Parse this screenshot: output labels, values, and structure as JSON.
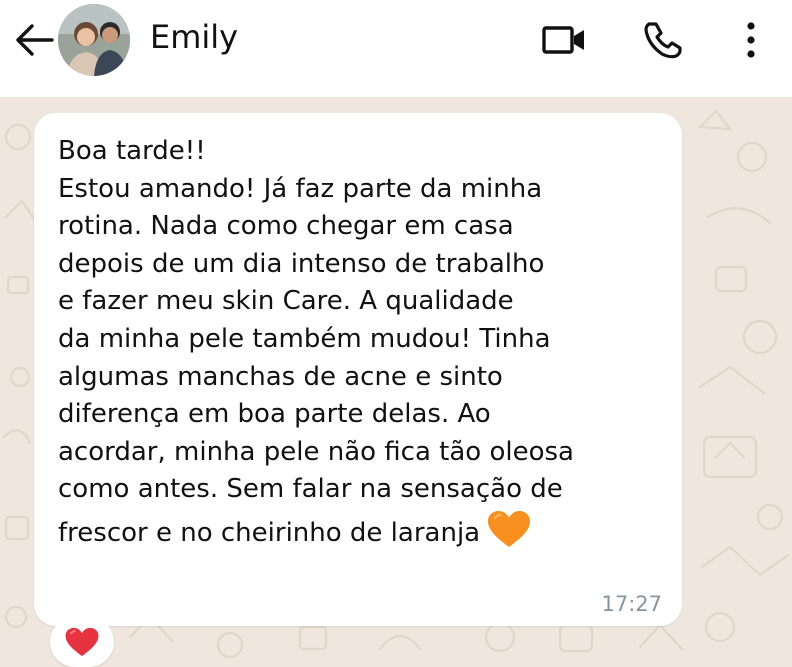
{
  "header": {
    "contact_name": "Emily",
    "back_icon": "arrow-left-icon",
    "video_icon": "video-camera-icon",
    "call_icon": "phone-icon",
    "more_icon": "more-vertical-icon",
    "background": "#ffffff"
  },
  "chat": {
    "background": "#efe7dd",
    "message": {
      "text": "Boa tarde!!\nEstou amando! Já faz parte da minha\nrotina. Nada como chegar em casa\ndepois de um dia intenso de trabalho\ne fazer meu skin Care. A qualidade\nda minha pele também mudou! Tinha\nalgumas manchas de acne e sinto\ndiferença em boa parte delas. Ao\nacordar, minha pele não fica tão oleosa\ncomo antes. Sem falar na sensação de\nfrescor e no cheirinho de laranja",
      "emoji": "orange-heart-icon",
      "time": "17:27",
      "bubble_color": "#ffffff",
      "time_color": "#8696a0"
    },
    "reaction": {
      "emoji": "red-heart-icon",
      "color": "#e8323f"
    }
  }
}
